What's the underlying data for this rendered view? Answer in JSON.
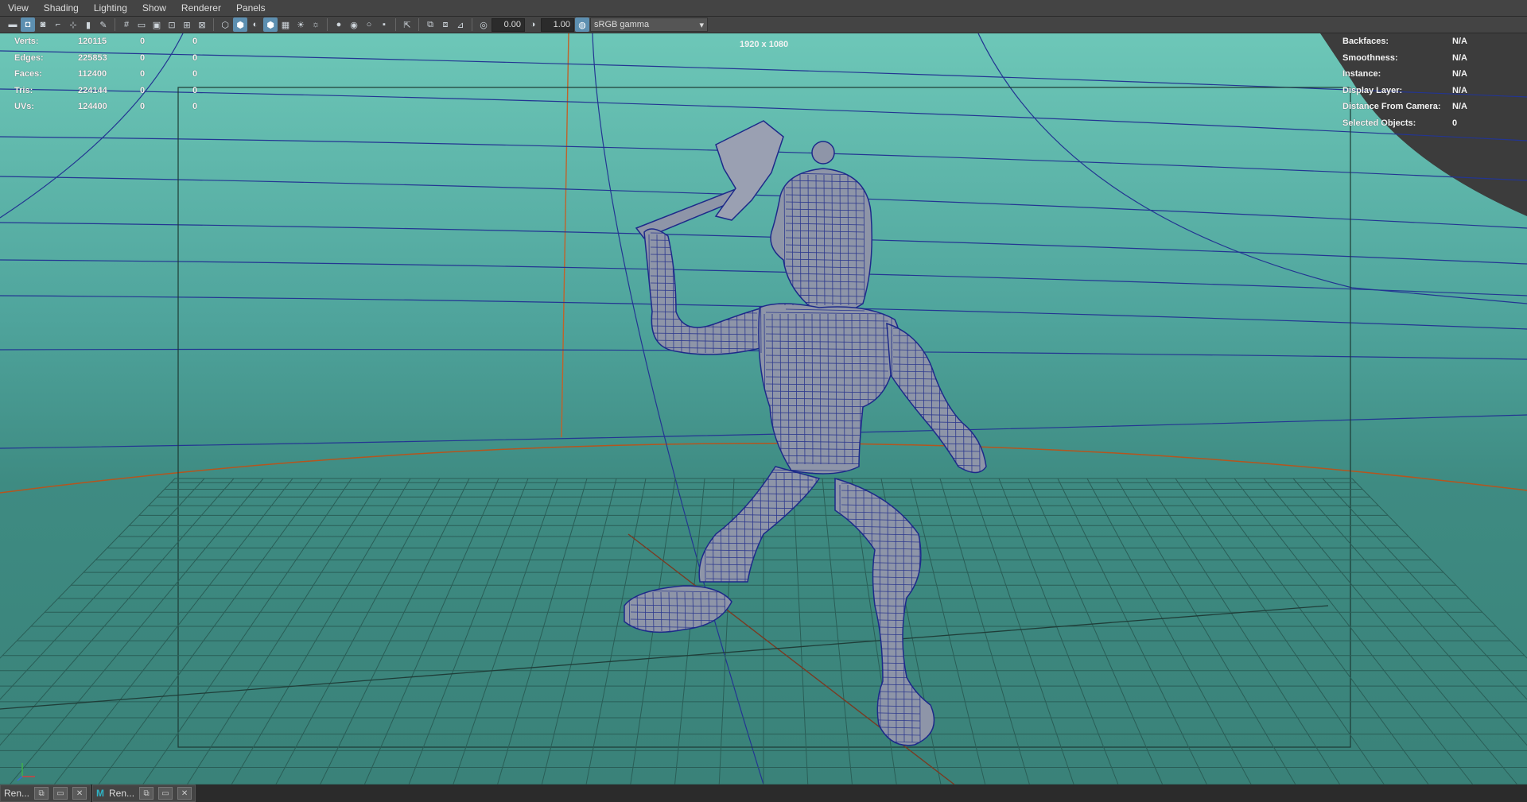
{
  "menus": [
    "View",
    "Shading",
    "Lighting",
    "Show",
    "Renderer",
    "Panels"
  ],
  "toolbar": {
    "exposure": "0.00",
    "gamma": "1.00",
    "color_space": "sRGB gamma"
  },
  "hud_left": {
    "rows": [
      {
        "label": "Verts:",
        "value": "120115",
        "selected": "0",
        "component": "0"
      },
      {
        "label": "Edges:",
        "value": "225853",
        "selected": "0",
        "component": "0"
      },
      {
        "label": "Faces:",
        "value": "112400",
        "selected": "0",
        "component": "0"
      },
      {
        "label": "Tris:",
        "value": "224144",
        "selected": "0",
        "component": "0"
      },
      {
        "label": "UVs:",
        "value": "124400",
        "selected": "0",
        "component": "0"
      }
    ]
  },
  "hud_right": {
    "rows": [
      {
        "label": "Backfaces:",
        "value": "N/A"
      },
      {
        "label": "Smoothness:",
        "value": "N/A"
      },
      {
        "label": "Instance:",
        "value": "N/A"
      },
      {
        "label": "Display Layer:",
        "value": "N/A"
      },
      {
        "label": "Distance From Camera:",
        "value": "N/A"
      },
      {
        "label": "Selected Objects:",
        "value": "0"
      }
    ]
  },
  "resolution_gate": "1920 x 1080",
  "camera": "persp",
  "taskbar": {
    "tab1": "Ren...",
    "tab2": "Ren..."
  },
  "colors": {
    "viewport_top": "#6dc7b8",
    "viewport_bottom": "#3a8279",
    "wire": "#1d2a8a",
    "mesh_fill": "#8e95a8",
    "axis_orange": "#b5551e"
  }
}
